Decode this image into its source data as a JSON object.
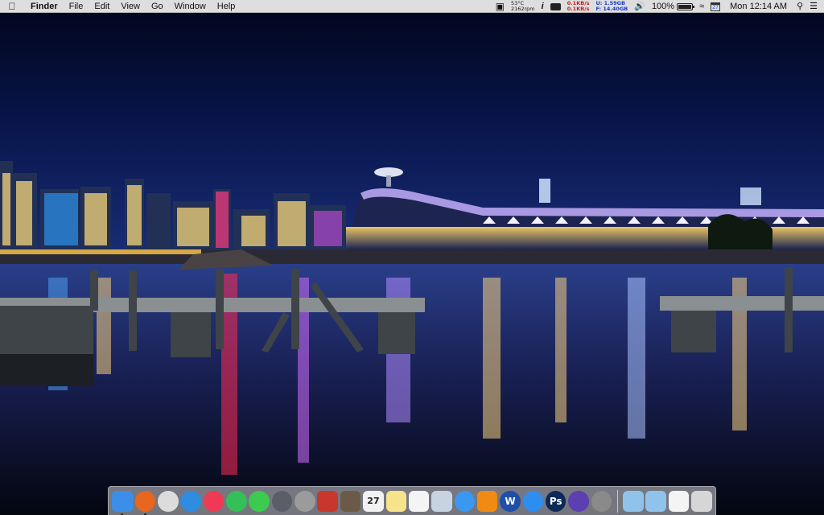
{
  "menubar": {
    "app_name": "Finder",
    "menus": [
      "File",
      "Edit",
      "View",
      "Go",
      "Window",
      "Help"
    ],
    "status": {
      "cpu_temp": "53°C",
      "fan_speed": "2162rpm",
      "net_up": "0.1KB/s",
      "net_down": "0.1KB/s",
      "disk_used": "U:  1.59GB",
      "disk_free": "F: 14.40GB",
      "battery_percent": "100%",
      "calendar_day": "27",
      "clock": "Mon 12:14 AM"
    }
  },
  "dock": {
    "apps": [
      {
        "name": "Finder",
        "icon": "finder-icon",
        "color": "#3b8fe8",
        "running": true
      },
      {
        "name": "Firefox",
        "icon": "firefox-icon",
        "color": "#e8661e",
        "running": true
      },
      {
        "name": "Chrome",
        "icon": "chrome-icon",
        "color": "#dcdcdc"
      },
      {
        "name": "Safari",
        "icon": "safari-icon",
        "color": "#2e8de0"
      },
      {
        "name": "iTunes",
        "icon": "itunes-icon",
        "color": "#f03955"
      },
      {
        "name": "Spotify",
        "icon": "spotify-icon",
        "color": "#34bf58"
      },
      {
        "name": "FaceTime",
        "icon": "facetime-icon",
        "color": "#3ccb4f"
      },
      {
        "name": "Launchpad",
        "icon": "launchpad-icon",
        "color": "#5a5e66"
      },
      {
        "name": "Contacts",
        "icon": "contacts-icon",
        "color": "#9b9b9b"
      },
      {
        "name": "Photo Booth",
        "icon": "photo-booth-icon",
        "color": "#c9362e"
      },
      {
        "name": "Notebook",
        "icon": "notebook-icon",
        "color": "#6b5a48"
      },
      {
        "name": "Calendar",
        "icon": "calendar-icon",
        "color": "#f2f2f2",
        "label": "27"
      },
      {
        "name": "Notes",
        "icon": "notes-icon",
        "color": "#f6e38a"
      },
      {
        "name": "Reminders",
        "icon": "reminders-icon",
        "color": "#f4f4f4"
      },
      {
        "name": "Preview",
        "icon": "preview-icon",
        "color": "#c7d3e0"
      },
      {
        "name": "Messages",
        "icon": "messages-icon",
        "color": "#3b98f0"
      },
      {
        "name": "VLC",
        "icon": "vlc-icon",
        "color": "#f08a12"
      },
      {
        "name": "Word",
        "icon": "word-icon",
        "color": "#1f4fa8",
        "label": "W"
      },
      {
        "name": "App Store",
        "icon": "app-store-icon",
        "color": "#2d8ef0"
      },
      {
        "name": "Photoshop",
        "icon": "photoshop-icon",
        "color": "#0c2a55",
        "label": "Ps"
      },
      {
        "name": "iMovie",
        "icon": "imovie-icon",
        "color": "#5c3fb0"
      },
      {
        "name": "System Preferences",
        "icon": "system-preferences-icon",
        "color": "#8a8a8a"
      }
    ],
    "right": [
      {
        "name": "Applications",
        "icon": "applications-folder-icon",
        "color": "#8fc3ec"
      },
      {
        "name": "Downloads",
        "icon": "downloads-folder-icon",
        "color": "#8fc3ec"
      },
      {
        "name": "Document",
        "icon": "document-icon",
        "color": "#f4f4f4"
      },
      {
        "name": "Trash",
        "icon": "trash-icon",
        "color": "#d6d6d6"
      }
    ]
  }
}
